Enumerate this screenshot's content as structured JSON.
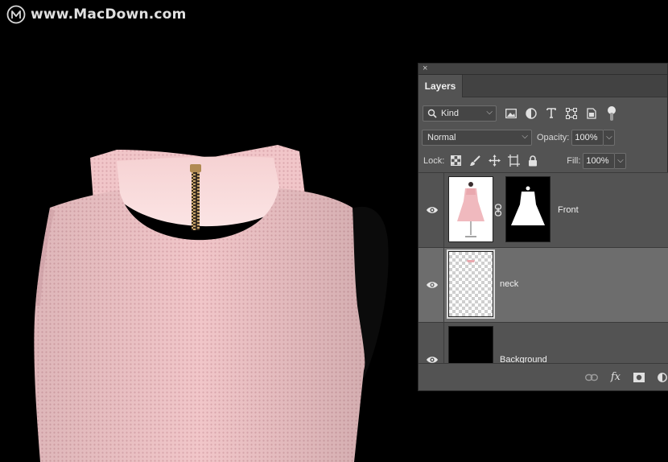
{
  "watermark": {
    "text": "www.MacDown.com",
    "logo_icon": "macdown-m-logo"
  },
  "canvas": {
    "background": "#000000",
    "subject_color": "#f1c6c9",
    "lining_color": "#f8d6d7",
    "zipper_color": "#b08a52"
  },
  "panel": {
    "close_label": "×",
    "tab_label": "Layers",
    "filter": {
      "kind_label": "Kind",
      "icons": [
        "image-filter-icon",
        "adjustment-filter-icon",
        "type-filter-icon",
        "shape-filter-icon",
        "smart-object-filter-icon"
      ]
    },
    "blend_mode": "Normal",
    "opacity_label": "Opacity:",
    "opacity_value": "100%",
    "lock_label": "Lock:",
    "lock_icons": [
      "lock-transparent-icon",
      "lock-image-icon",
      "lock-position-icon",
      "lock-artboard-icon",
      "lock-all-icon"
    ],
    "fill_label": "Fill:",
    "fill_value": "100%",
    "layers": [
      {
        "name": "Front",
        "visible": true,
        "selected": false,
        "has_mask": true
      },
      {
        "name": "neck",
        "visible": true,
        "selected": true,
        "has_mask": false
      },
      {
        "name": "Background",
        "visible": true,
        "selected": false,
        "has_mask": false
      }
    ],
    "footer_icons": [
      "link-layers-icon",
      "fx-icon",
      "add-mask-icon",
      "adjustment-layer-icon"
    ],
    "fx_label": "fx"
  }
}
